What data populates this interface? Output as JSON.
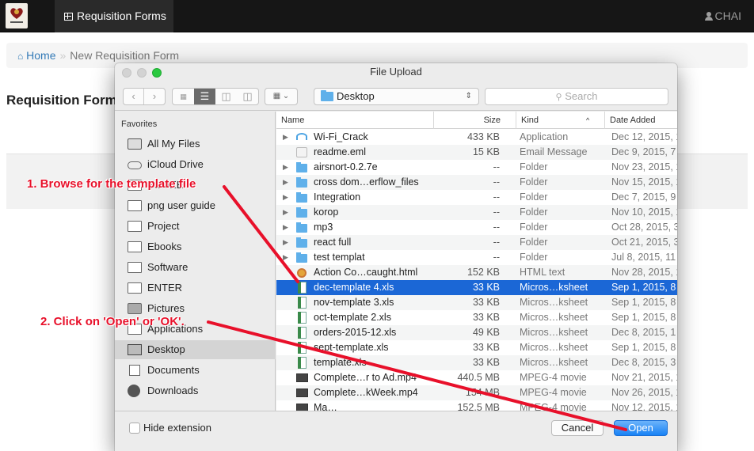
{
  "navbar": {
    "nav_tab": "Requisition Forms",
    "user": "CHAI"
  },
  "breadcrumb": {
    "home": "Home",
    "separator": "»",
    "current": "New Requisition Form"
  },
  "page": {
    "title": "Requisition Form"
  },
  "dialog": {
    "title": "File Upload",
    "location": "Desktop",
    "search_placeholder": "Search",
    "sidebar": {
      "heading": "Favorites",
      "items": [
        {
          "label": "All My Files",
          "icon": "all-files-icon"
        },
        {
          "label": "iCloud Drive",
          "icon": "cloud-icon"
        },
        {
          "label": "ESMEE",
          "icon": "folder-icon"
        },
        {
          "label": "png user guide",
          "icon": "folder-icon"
        },
        {
          "label": "Project",
          "icon": "folder-icon"
        },
        {
          "label": "Ebooks",
          "icon": "folder-icon"
        },
        {
          "label": "Software",
          "icon": "folder-icon"
        },
        {
          "label": "ENTER",
          "icon": "folder-icon"
        },
        {
          "label": "Pictures",
          "icon": "camera-icon"
        },
        {
          "label": "Applications",
          "icon": "applications-icon"
        },
        {
          "label": "Desktop",
          "icon": "desktop-icon",
          "selected": true
        },
        {
          "label": "Documents",
          "icon": "documents-icon"
        },
        {
          "label": "Downloads",
          "icon": "download-icon"
        }
      ]
    },
    "columns": {
      "name": "Name",
      "size": "Size",
      "kind": "Kind",
      "sort_indicator": "^",
      "date": "Date Added"
    },
    "files": [
      {
        "name": "Wi-Fi_Crack",
        "size": "433 KB",
        "kind": "Application",
        "date": "Dec 12, 2015, 1",
        "icon": "wifi",
        "expandable": true
      },
      {
        "name": "readme.eml",
        "size": "15 KB",
        "kind": "Email Message",
        "date": "Dec 9, 2015, 7",
        "icon": "mail",
        "expandable": false
      },
      {
        "name": "airsnort-0.2.7e",
        "size": "--",
        "kind": "Folder",
        "date": "Nov 23, 2015, 1",
        "icon": "fold",
        "expandable": true
      },
      {
        "name": "cross dom…erflow_files",
        "size": "--",
        "kind": "Folder",
        "date": "Nov 15, 2015, 1",
        "icon": "fold",
        "expandable": true
      },
      {
        "name": "Integration",
        "size": "--",
        "kind": "Folder",
        "date": "Dec 7, 2015, 9",
        "icon": "fold",
        "expandable": true
      },
      {
        "name": "korop",
        "size": "--",
        "kind": "Folder",
        "date": "Nov 10, 2015, 1",
        "icon": "fold",
        "expandable": true
      },
      {
        "name": "mp3",
        "size": "--",
        "kind": "Folder",
        "date": "Oct 28, 2015, 3",
        "icon": "fold",
        "expandable": true
      },
      {
        "name": "react full",
        "size": "--",
        "kind": "Folder",
        "date": "Oct 21, 2015, 3",
        "icon": "fold",
        "expandable": true
      },
      {
        "name": "test templat",
        "size": "--",
        "kind": "Folder",
        "date": "Jul 8, 2015, 11",
        "icon": "fold",
        "expandable": true
      },
      {
        "name": "Action Co…caught.html",
        "size": "152 KB",
        "kind": "HTML text",
        "date": "Nov 28, 2015, 1",
        "icon": "html",
        "expandable": false
      },
      {
        "name": "dec-template 4.xls",
        "size": "33 KB",
        "kind": "Micros…ksheet",
        "date": "Sep 1, 2015, 8",
        "icon": "xls",
        "expandable": false,
        "selected": true
      },
      {
        "name": "nov-template 3.xls",
        "size": "33 KB",
        "kind": "Micros…ksheet",
        "date": "Sep 1, 2015, 8",
        "icon": "xls",
        "expandable": false
      },
      {
        "name": "oct-template 2.xls",
        "size": "33 KB",
        "kind": "Micros…ksheet",
        "date": "Sep 1, 2015, 8",
        "icon": "xls",
        "expandable": false
      },
      {
        "name": "orders-2015-12.xls",
        "size": "49 KB",
        "kind": "Micros…ksheet",
        "date": "Dec 8, 2015, 1",
        "icon": "xls",
        "expandable": false
      },
      {
        "name": "sept-template.xls",
        "size": "33 KB",
        "kind": "Micros…ksheet",
        "date": "Sep 1, 2015, 8",
        "icon": "xls",
        "expandable": false
      },
      {
        "name": "template.xls",
        "size": "33 KB",
        "kind": "Micros…ksheet",
        "date": "Dec 8, 2015, 3",
        "icon": "xls",
        "expandable": false
      },
      {
        "name": "Complete…r to Ad.mp4",
        "size": "440.5 MB",
        "kind": "MPEG-4 movie",
        "date": "Nov 21, 2015, 1",
        "icon": "vid",
        "expandable": false
      },
      {
        "name": "Complete…kWeek.mp4",
        "size": "154 MB",
        "kind": "MPEG-4 movie",
        "date": "Nov 26, 2015, 1",
        "icon": "vid",
        "expandable": false
      },
      {
        "name": "Ma…",
        "size": "152.5 MB",
        "kind": "MPEG-4 movie",
        "date": "Nov 12, 2015, 1",
        "icon": "vid",
        "expandable": false
      }
    ],
    "hide_extension_label": "Hide extension",
    "cancel_label": "Cancel",
    "open_label": "Open"
  },
  "annotations": {
    "step1": "1. Browse for the template file",
    "step2": "2. Click on 'Open' or 'OK'."
  },
  "colors": {
    "navbar_bg": "#161616",
    "link": "#337ab7",
    "selection": "#1b67d6",
    "annotation": "#e8102a"
  }
}
